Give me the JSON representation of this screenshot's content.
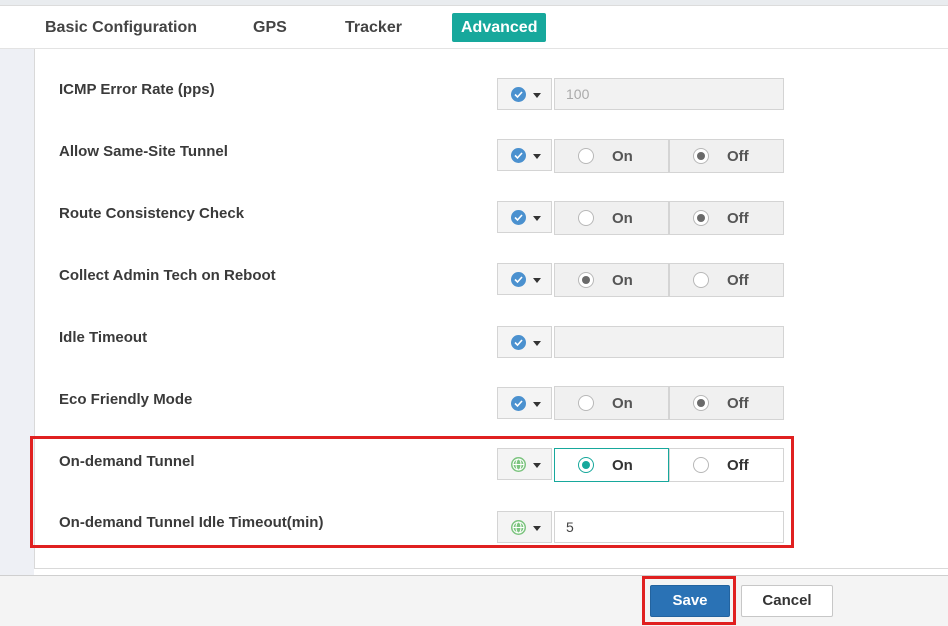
{
  "tabs": [
    {
      "label": "Basic Configuration"
    },
    {
      "label": "GPS"
    },
    {
      "label": "Tracker"
    },
    {
      "label": "Advanced",
      "active": true
    }
  ],
  "rows": {
    "icmp": {
      "label": "ICMP Error Rate (pps)",
      "scope_icon": "check-circle-icon",
      "value": "100"
    },
    "same_site": {
      "label": "Allow Same-Site Tunnel",
      "scope_icon": "check-circle-icon",
      "on": "On",
      "off": "Off",
      "selected": "Off"
    },
    "route_check": {
      "label": "Route Consistency Check",
      "scope_icon": "check-circle-icon",
      "on": "On",
      "off": "Off",
      "selected": "Off"
    },
    "admin_tech": {
      "label": "Collect Admin Tech on Reboot",
      "scope_icon": "check-circle-icon",
      "on": "On",
      "off": "Off",
      "selected": "On"
    },
    "idle_timeout": {
      "label": "Idle Timeout",
      "scope_icon": "check-circle-icon",
      "value": ""
    },
    "eco": {
      "label": "Eco Friendly Mode",
      "scope_icon": "check-circle-icon",
      "on": "On",
      "off": "Off",
      "selected": "Off"
    },
    "on_demand": {
      "label": "On-demand Tunnel",
      "scope_icon": "globe-icon",
      "on": "On",
      "off": "Off",
      "selected": "On"
    },
    "on_demand_timeout": {
      "label": "On-demand Tunnel Idle Timeout(min)",
      "scope_icon": "globe-icon",
      "value": "5"
    }
  },
  "footer": {
    "save": "Save",
    "cancel": "Cancel"
  },
  "colors": {
    "accent": "#17a89c",
    "save_button": "#2a72b5",
    "highlight": "#e02020",
    "check_icon": "#4b91cf",
    "globe_icon": "#7cc47f"
  }
}
